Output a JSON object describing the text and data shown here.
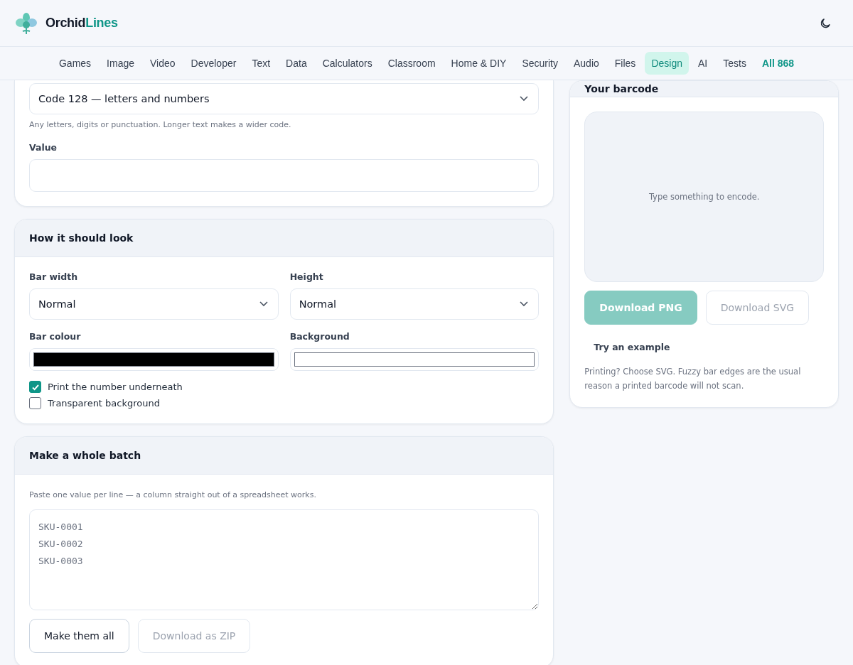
{
  "header": {
    "brand": {
      "first": "Orchid",
      "second": "Lines"
    }
  },
  "nav": [
    {
      "label": "Games",
      "selected": false,
      "kind": "link"
    },
    {
      "label": "Image",
      "selected": false,
      "kind": "link"
    },
    {
      "label": "Video",
      "selected": false,
      "kind": "link"
    },
    {
      "label": "Developer",
      "selected": false,
      "kind": "link"
    },
    {
      "label": "Text",
      "selected": false,
      "kind": "link"
    },
    {
      "label": "Data",
      "selected": false,
      "kind": "link"
    },
    {
      "label": "Calculators",
      "selected": false,
      "kind": "link"
    },
    {
      "label": "Classroom",
      "selected": false,
      "kind": "link"
    },
    {
      "label": "Home & DIY",
      "selected": false,
      "kind": "link"
    },
    {
      "label": "Security",
      "selected": false,
      "kind": "link"
    },
    {
      "label": "Audio",
      "selected": false,
      "kind": "link"
    },
    {
      "label": "Files",
      "selected": false,
      "kind": "link"
    },
    {
      "label": "Design",
      "selected": true,
      "kind": "link"
    },
    {
      "label": "AI",
      "selected": false,
      "kind": "link"
    },
    {
      "label": "Tests",
      "selected": false,
      "kind": "link"
    },
    {
      "label": "All 868",
      "selected": false,
      "kind": "all"
    }
  ],
  "symbology": {
    "value": "Code 128 — letters and numbers",
    "hint": "Any letters, digits or punctuation. Longer text makes a wider code."
  },
  "value_field": {
    "label": "Value"
  },
  "look": {
    "title": "How it should look",
    "selects": [
      {
        "label": "Bar width",
        "value": "Normal"
      },
      {
        "label": "Height",
        "value": "Normal"
      }
    ],
    "colours": [
      {
        "label": "Bar colour",
        "color": "#000000"
      },
      {
        "label": "Background",
        "color": "#ffffff"
      }
    ],
    "checkboxes": [
      {
        "label": "Print the number underneath",
        "checked": true
      },
      {
        "label": "Transparent background",
        "checked": false
      }
    ]
  },
  "batch": {
    "title": "Make a whole batch",
    "hint": "Paste one value per line — a column straight out of a spreadsheet works.",
    "placeholder": "SKU-0001\nSKU-0002\nSKU-0003",
    "buttons": [
      {
        "label": "Make them all",
        "disabled": false
      },
      {
        "label": "Download as ZIP",
        "disabled": true
      }
    ]
  },
  "preview": {
    "title": "Your barcode",
    "empty_text": "Type something to encode.",
    "buttons": [
      {
        "label": "Download PNG",
        "kind": "primary",
        "disabled": true
      },
      {
        "label": "Download SVG",
        "kind": "secondary",
        "disabled": true
      }
    ],
    "example_link": "Try an example",
    "note": "Printing? Choose SVG. Fuzzy bar edges are the usual reason a printed barcode will not scan."
  }
}
